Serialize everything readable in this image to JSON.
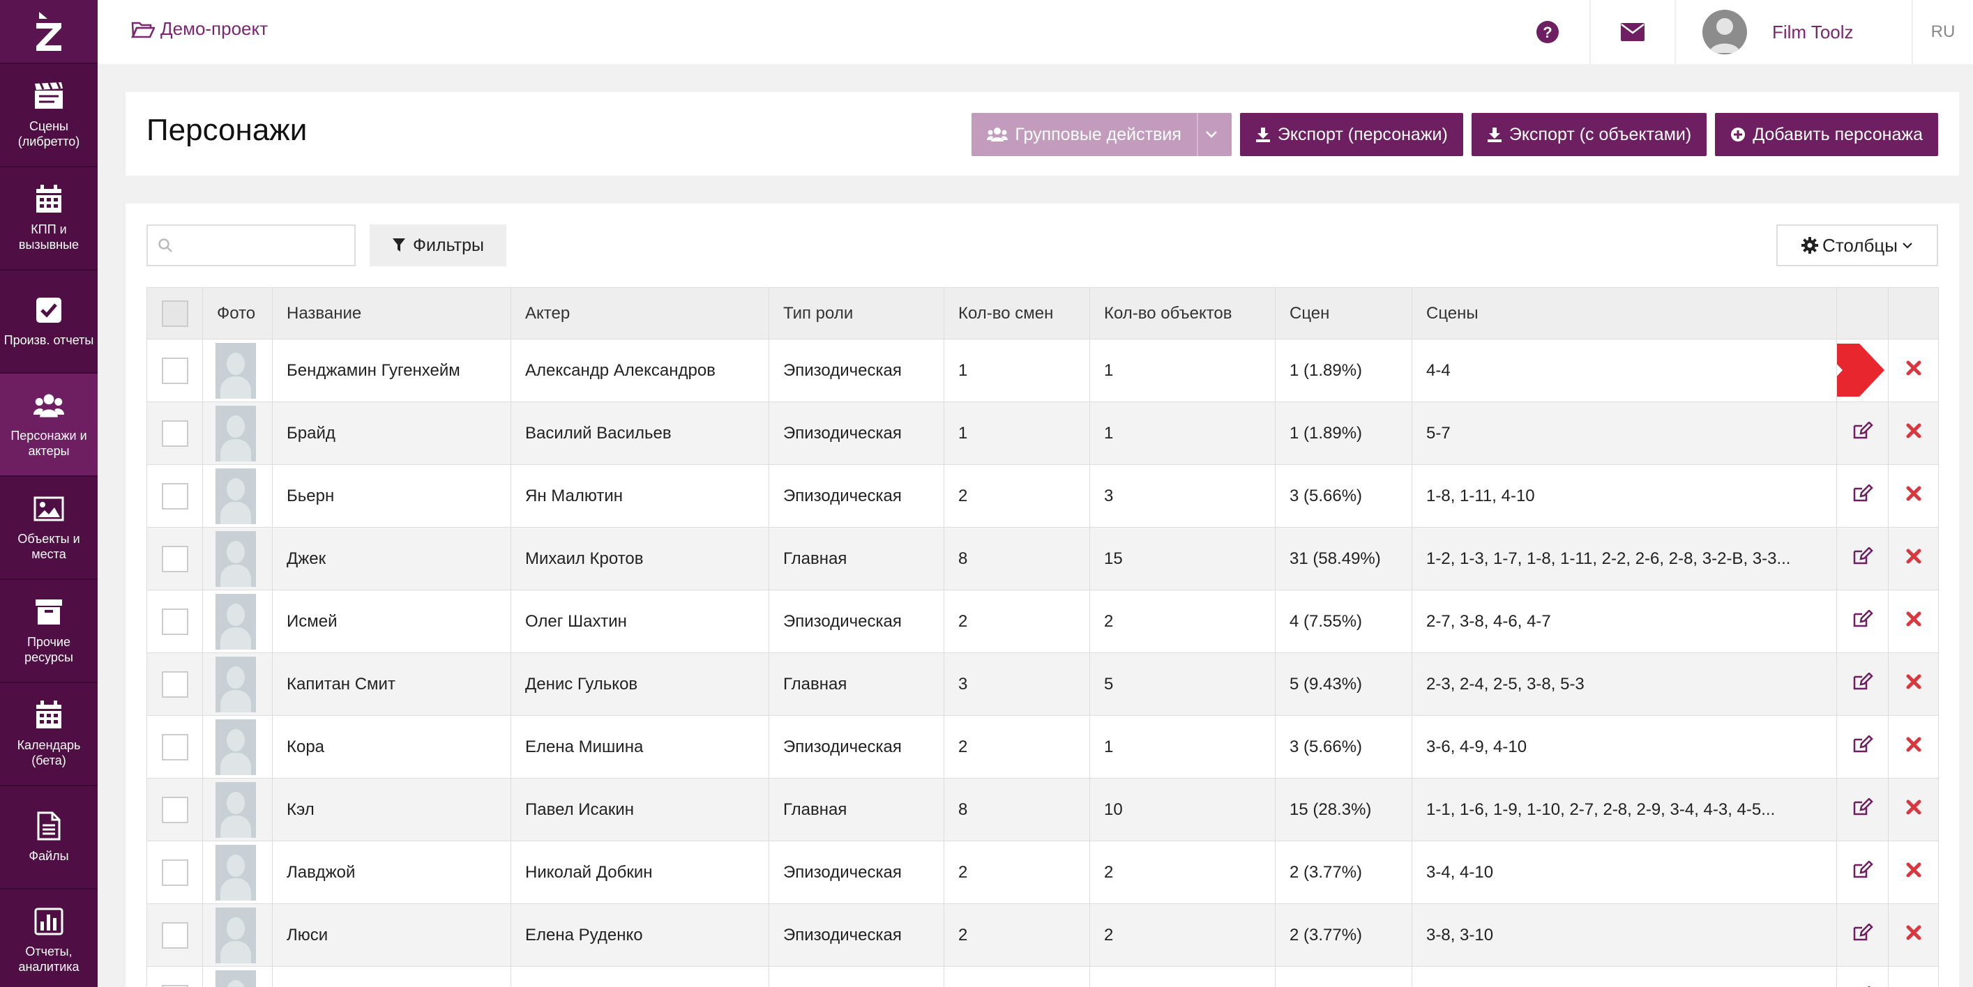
{
  "sidebar": {
    "logo": "Z",
    "items": [
      {
        "label": "Сцены\n(либретто)",
        "icon": "clapperboard-icon"
      },
      {
        "label": "КПП и\nвызывные",
        "icon": "calendar-icon"
      },
      {
        "label": "Произв. отчеты",
        "icon": "checkbox-icon"
      },
      {
        "label": "Персонажи и\nактеры",
        "icon": "users-icon",
        "active": true
      },
      {
        "label": "Объекты и\nместа",
        "icon": "image-icon"
      },
      {
        "label": "Прочие\nресурсы",
        "icon": "archive-icon"
      },
      {
        "label": "Календарь\n(бета)",
        "icon": "calendar-icon"
      },
      {
        "label": "Файлы",
        "icon": "file-icon"
      },
      {
        "label": "Отчеты,\nаналитика",
        "icon": "chart-icon"
      }
    ]
  },
  "topbar": {
    "project": "Демо-проект",
    "user_name": "Film Toolz",
    "lang": "RU"
  },
  "header": {
    "title": "Персонажи",
    "group_actions": "Групповые действия",
    "export_characters": "Экспорт (персонажи)",
    "export_objects": "Экспорт (с объектами)",
    "add_character": "Добавить персонажа"
  },
  "toolbar": {
    "search_placeholder": "",
    "filters": "Фильтры",
    "columns": "Столбцы"
  },
  "table": {
    "headers": [
      "",
      "Фото",
      "Название",
      "Актер",
      "Тип роли",
      "Кол-во смен",
      "Кол-во объектов",
      "Сцен",
      "Сцены",
      "",
      ""
    ],
    "rows": [
      [
        "Бенджамин Гугенхейм",
        "Александр Александров",
        "Эпизодическая",
        "1",
        "1",
        "1 (1.89%)",
        "4-4"
      ],
      [
        "Брайд",
        "Василий Васильев",
        "Эпизодическая",
        "1",
        "1",
        "1 (1.89%)",
        "5-7"
      ],
      [
        "Бьерн",
        "Ян Малютин",
        "Эпизодическая",
        "2",
        "3",
        "3 (5.66%)",
        "1-8, 1-11, 4-10"
      ],
      [
        "Джек",
        "Михаил Кротов",
        "Главная",
        "8",
        "15",
        "31 (58.49%)",
        "1-2, 1-3, 1-7, 1-8, 1-11, 2-2, 2-6, 2-8, 3-2-B, 3-3..."
      ],
      [
        "Исмей",
        "Олег Шахтин",
        "Эпизодическая",
        "2",
        "2",
        "4 (7.55%)",
        "2-7, 3-8, 4-6, 4-7"
      ],
      [
        "Капитан Смит",
        "Денис Гульков",
        "Главная",
        "3",
        "5",
        "5 (9.43%)",
        "2-3, 2-4, 2-5, 3-8, 5-3"
      ],
      [
        "Кора",
        "Елена Мишина",
        "Эпизодическая",
        "2",
        "1",
        "3 (5.66%)",
        "3-6, 4-9, 4-10"
      ],
      [
        "Кэл",
        "Павел Исакин",
        "Главная",
        "8",
        "10",
        "15 (28.3%)",
        "1-1, 1-6, 1-9, 1-10, 2-7, 2-8, 2-9, 3-4, 4-3, 4-5..."
      ],
      [
        "Лавджой",
        "Николай Добкин",
        "Эпизодическая",
        "2",
        "2",
        "2 (3.77%)",
        "3-4, 4-10"
      ],
      [
        "Люси",
        "Елена Руденко",
        "Эпизодическая",
        "2",
        "2",
        "2 (3.77%)",
        "3-8, 3-10"
      ],
      [
        "",
        "",
        "",
        "",
        "",
        "",
        ""
      ]
    ]
  },
  "colors": {
    "sidebar": "#4f0f44",
    "accent": "#6d1f62",
    "accent_disabled": "#c29bbd",
    "delete": "#d9363e",
    "arrow_highlight": "#e8262e"
  }
}
